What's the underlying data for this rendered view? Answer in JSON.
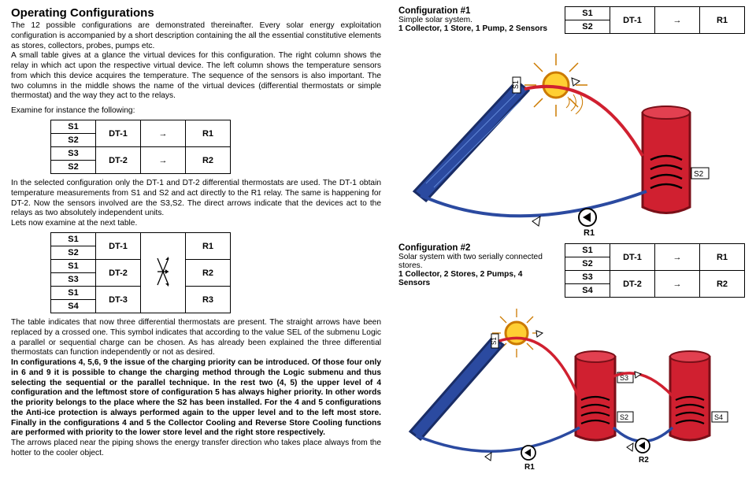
{
  "title": "Operating Configurations",
  "intro1": "The 12 possible configurations are demonstrated thereinafter. Every solar energy exploitation configuration is accompanied by a short description containing the all the essential constitutive elements as stores, collectors, probes, pumps etc.",
  "intro2": "A small table gives at a glance the virtual devices for this configuration. The right column shows the relay in which act upon the respective virtual device. The left column shows the temperature sensors from which this device acquires the temperature. The sequence of the sensors is also important. The two columns in the middle shows the name of the virtual devices (differential thermostats or simple thermostat) and the way they act to the relays.",
  "examine_line": "Examine for instance the following:",
  "tableA": {
    "rows": [
      {
        "sensors": [
          "S1",
          "S2"
        ],
        "device": "DT-1",
        "arrow": "→",
        "relay": "R1"
      },
      {
        "sensors": [
          "S3",
          "S2"
        ],
        "device": "DT-2",
        "arrow": "→",
        "relay": "R2"
      }
    ]
  },
  "explain_tableA": "In the selected configuration only the DT-1 and DT-2 differential thermostats are used. The DT-1 obtain temperature measurements from S1 and S2 and act directly to the R1 relay. The same is happening for DT-2. Now the sensors involved are the S3,S2. The direct arrows indicate that the devices act to the relays as two absolutely independent units.",
  "examine_next": "Lets now examine at the next table.",
  "tableB": {
    "rows": [
      {
        "sensors": [
          "S1",
          "S2"
        ],
        "device": "DT-1",
        "arrow": "",
        "relay": "R1"
      },
      {
        "sensors": [
          "S1",
          "S3"
        ],
        "device": "DT-2",
        "arrow": "✕",
        "relay": "R2"
      },
      {
        "sensors": [
          "S1",
          "S4"
        ],
        "device": "DT-3",
        "arrow": "",
        "relay": "R3"
      }
    ]
  },
  "explain_tableB": "The table indicates that now three differential thermostats are present. The straight arrows have been replaced by a crossed one. This symbol indicates that  according to the value SEL of the submenu Logic a parallel or sequential charge can be chosen. As has already been explained the three differential thermostats can function independently or not as desired.",
  "priority_para": "In configurations 4, 5,6, 9 the issue of the charging priority can be introduced. Of those four only in 6 and 9 it is possible to change the charging method through the Logic submenu and thus selecting the sequential or the parallel technique. In the rest two (4, 5) the upper level of 4 configuration and the leftmost store of configuration 5 has always higher priority. In other words the priority belongs to the place where the S2 has been installed. For the 4 and 5 configurations the Anti-ice protection is always performed again to the upper level and to the left most store. Finally in the configurations 4 and 5 the Collector Cooling and Reverse Store Cooling functions are performed with priority to the lower store level and the right store respectively.",
  "arrows_note": "The arrows placed near the piping shows the energy transfer direction who takes place always from the hotter to the cooler object.",
  "config1": {
    "title": "Configuration #1",
    "subtitle": "Simple solar system.",
    "summary": "1 Collector, 1 Store, 1 Pump, 2 Sensors",
    "table": {
      "rows": [
        {
          "sensors": [
            "S1",
            "S2"
          ],
          "device": "DT-1",
          "arrow": "→",
          "relay": "R1"
        }
      ]
    },
    "labels": {
      "s1": "S1",
      "s2": "S2",
      "r1": "R1"
    }
  },
  "config2": {
    "title": "Configuration #2",
    "subtitle": "Solar system with two serially connected stores.",
    "summary": "1 Collector, 2 Stores, 2 Pumps, 4 Sensors",
    "table": {
      "rows": [
        {
          "sensors": [
            "S1",
            "S2"
          ],
          "device": "DT-1",
          "arrow": "→",
          "relay": "R1"
        },
        {
          "sensors": [
            "S3",
            "S4"
          ],
          "device": "DT-2",
          "arrow": "→",
          "relay": "R2"
        }
      ]
    },
    "labels": {
      "s1": "S1",
      "s2": "S2",
      "s3": "S3",
      "s4": "S4",
      "r1": "R1",
      "r2": "R2"
    }
  }
}
